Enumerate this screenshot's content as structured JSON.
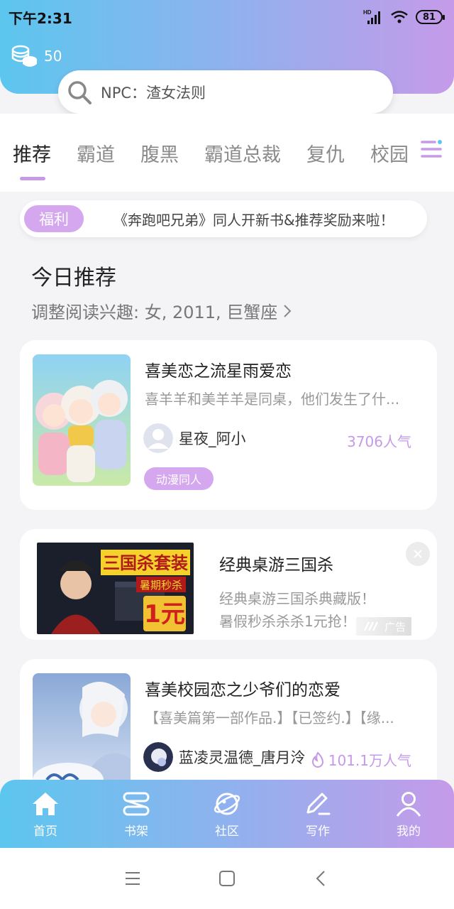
{
  "status_bar": {
    "time": "下午2:31",
    "battery": "81",
    "network": "HD"
  },
  "header": {
    "coins": "50"
  },
  "search": {
    "placeholder": "NPC：渣女法则"
  },
  "tabs": [
    "推荐",
    "霸道",
    "腹黑",
    "霸道总裁",
    "复仇",
    "校园"
  ],
  "notice": {
    "badge": "福利",
    "text": "《奔跑吧兄弟》同人开新书&推荐奖励来啦！"
  },
  "today": {
    "title": "今日推荐",
    "subtitle": "调整阅读兴趣: 女, 2011, 巨蟹座"
  },
  "books": [
    {
      "title": "喜美恋之流星雨爱恋",
      "description": "喜羊羊和美羊羊是同桌，他们发生了什...",
      "author": "星夜_阿小",
      "popularity": "3706人气",
      "tag": "动漫同人"
    },
    {
      "title": "喜美校园恋之少爷们的恋爱",
      "description": "【喜美篇第一部作品.】【已签约.】【缘...",
      "author": "蓝凌灵温德_唐月泠",
      "popularity": "101.1万人气"
    }
  ],
  "ad": {
    "title": "经典桌游三国杀",
    "line1": "经典桌游三国杀典藏版！",
    "line2": "暑假秒杀杀杀1元抢！",
    "label": "广告",
    "image_heading": "三国杀套装",
    "image_sub": "暑期秒杀",
    "image_price": "1元"
  },
  "bottom_nav": [
    {
      "label": "首页",
      "icon": "home-icon"
    },
    {
      "label": "书架",
      "icon": "bookshelf-icon"
    },
    {
      "label": "社区",
      "icon": "planet-icon"
    },
    {
      "label": "写作",
      "icon": "pen-icon"
    },
    {
      "label": "我的",
      "icon": "profile-icon"
    }
  ],
  "colors": {
    "accent": "#c59ae9",
    "gradient_start": "#5cc6ee",
    "gradient_end": "#c59ae9"
  }
}
